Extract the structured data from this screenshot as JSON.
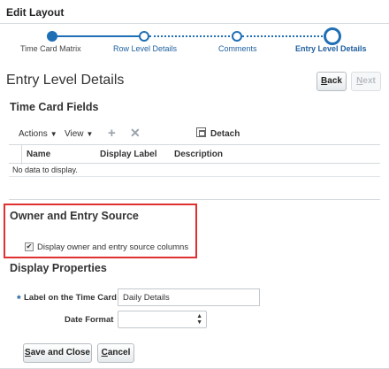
{
  "dialog": {
    "title": "Edit Layout"
  },
  "train": {
    "steps": [
      {
        "label": "Time Card Matrix",
        "state": "visited"
      },
      {
        "label": "Row Level Details",
        "state": "unvisited"
      },
      {
        "label": "Comments",
        "state": "unvisited"
      },
      {
        "label": "Entry Level Details",
        "state": "current"
      }
    ]
  },
  "page": {
    "title": "Entry Level Details"
  },
  "nav": {
    "back_mnemonic": "B",
    "back_rest": "ack",
    "next_mnemonic": "N",
    "next_rest": "ext",
    "next_disabled": true
  },
  "time_card_fields": {
    "title": "Time Card Fields",
    "toolbar": {
      "actions_label": "Actions",
      "view_label": "View",
      "add_icon": "plus-icon",
      "delete_icon": "x-icon",
      "detach_label": "Detach"
    },
    "columns": [
      "Name",
      "Display Label",
      "Description"
    ],
    "empty_message": "No data to display."
  },
  "owner_entry_source": {
    "title": "Owner and Entry Source",
    "checkbox_label": "Display owner and entry source columns",
    "checked": true
  },
  "display_properties": {
    "title": "Display Properties",
    "label_field_label": "Label on the Time Card",
    "label_field_value": "Daily Details",
    "label_field_required": true,
    "date_format_label": "Date Format",
    "date_format_value": ""
  },
  "footer": {
    "save_mnemonic": "S",
    "save_rest": "ave and Close",
    "cancel_mnemonic": "C",
    "cancel_rest": "ancel"
  },
  "colors": {
    "accent": "#1f6fb5",
    "highlight": "#e03030"
  }
}
